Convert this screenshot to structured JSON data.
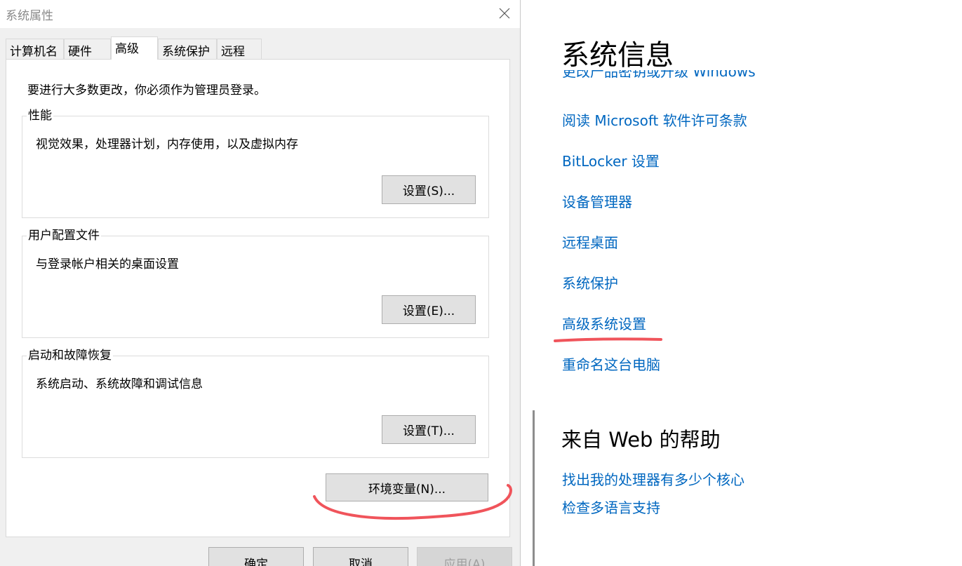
{
  "dialog": {
    "title": "系统属性",
    "tabs": [
      "计算机名",
      "硬件",
      "高级",
      "系统保护",
      "远程"
    ],
    "active_tab": "高级",
    "note": "要进行大多数更改，你必须作为管理员登录。",
    "groups": [
      {
        "title": "性能",
        "description": "视觉效果，处理器计划，内存使用，以及虚拟内存",
        "button": "设置(S)..."
      },
      {
        "title": "用户配置文件",
        "description": "与登录帐户相关的桌面设置",
        "button": "设置(E)..."
      },
      {
        "title": "启动和故障恢复",
        "description": "系统启动、系统故障和调试信息",
        "button": "设置(T)..."
      }
    ],
    "env_button": "环境变量(N)...",
    "footer": {
      "ok": "确定",
      "cancel": "取消",
      "apply": "应用(A)"
    }
  },
  "settings_pane": {
    "title": "系统信息",
    "links": [
      "更改产品密钥或升级 Windows",
      "阅读 Microsoft 软件许可条款",
      "BitLocker 设置",
      "设备管理器",
      "远程桌面",
      "系统保护",
      "高级系统设置",
      "重命名这台电脑"
    ],
    "help_title": "来自 Web 的帮助",
    "help_links": [
      "找出我的处理器有多少个核心",
      "检查多语言支持"
    ]
  },
  "colors": {
    "link": "#0067c0",
    "annotation": "#f0545b"
  }
}
